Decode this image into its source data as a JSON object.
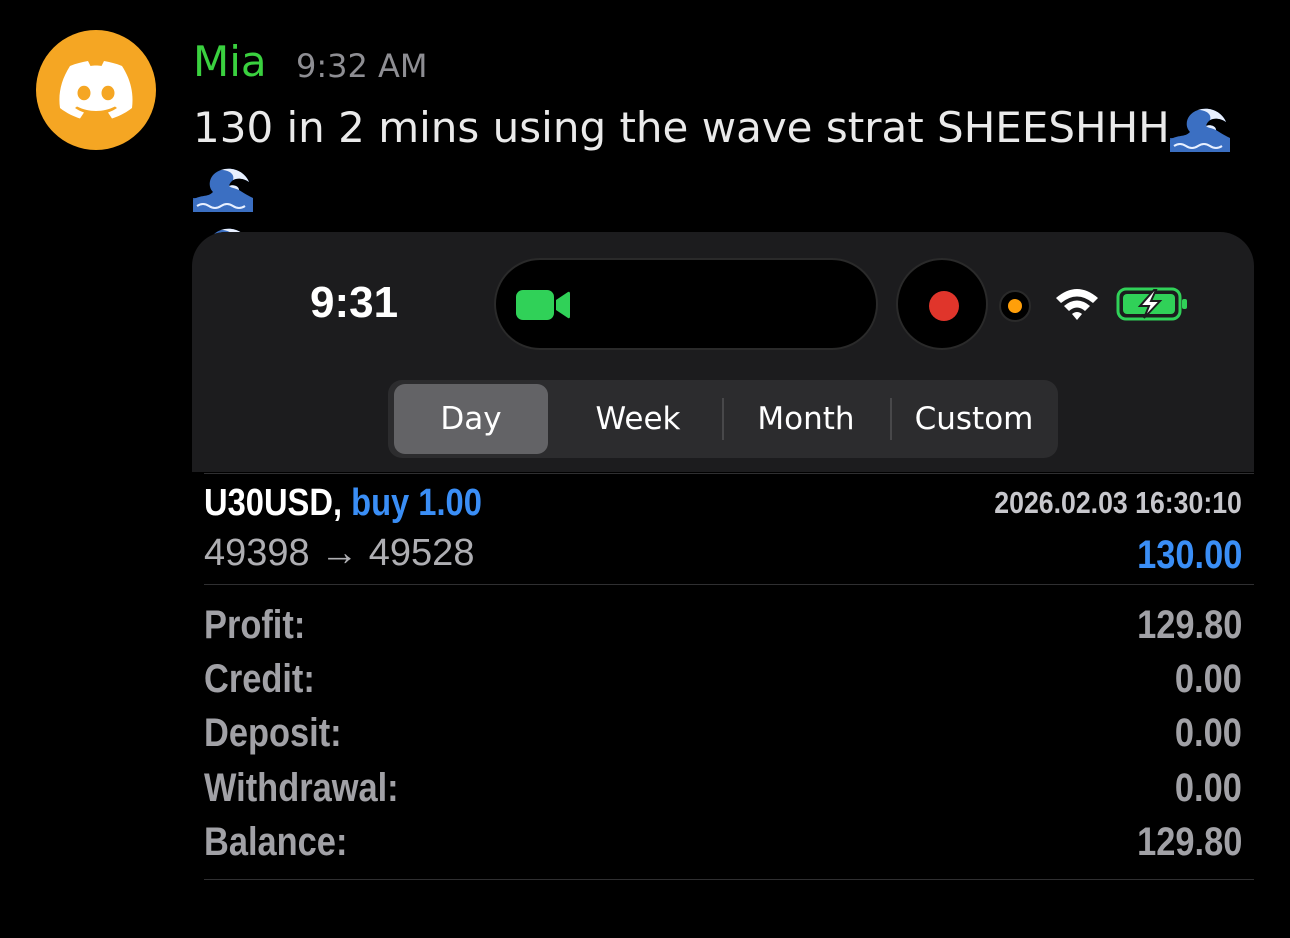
{
  "message": {
    "avatar_icon": "discord-logo-icon",
    "avatar_color": "#f5a623",
    "username": "Mia",
    "username_color": "#3ad13f",
    "timestamp": "9:32 AM",
    "text": "130 in 2 mins using the wave strat SHEESHHH",
    "emoji": "water-wave-emoji",
    "emoji_count": 3
  },
  "screenshot": {
    "status_bar": {
      "time": "9:31",
      "icons": [
        "facetime-camera-icon",
        "screen-record-icon",
        "mic-indicator-icon",
        "wifi-icon",
        "battery-charging-icon"
      ]
    },
    "period_tabs": {
      "items": [
        "Day",
        "Week",
        "Month",
        "Custom"
      ],
      "selected": "Day"
    },
    "trade": {
      "symbol": "U30USD,",
      "side": "buy 1.00",
      "datetime": "2026.02.03 16:30:10",
      "prices": "49398 → 49528",
      "profit": "130.00",
      "accent_color": "#3a8ef6"
    },
    "summary": [
      {
        "label": "Profit:",
        "value": "129.80"
      },
      {
        "label": "Credit:",
        "value": "0.00"
      },
      {
        "label": "Deposit:",
        "value": "0.00"
      },
      {
        "label": "Withdrawal:",
        "value": "0.00"
      },
      {
        "label": "Balance:",
        "value": "129.80"
      }
    ]
  }
}
